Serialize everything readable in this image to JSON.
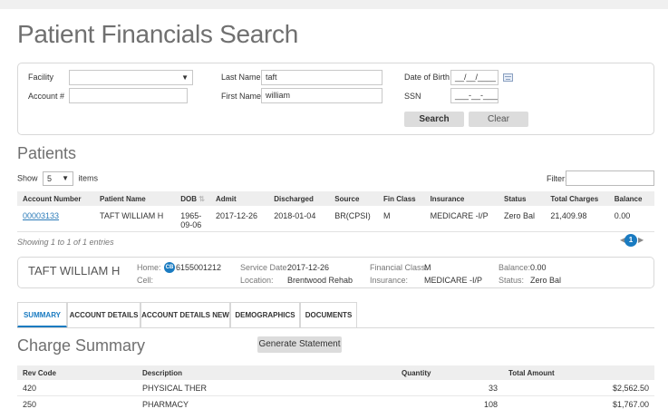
{
  "page_title": "Patient Financials Search",
  "search": {
    "facility_label": "Facility",
    "facility_value": "",
    "account_label": "Account #",
    "account_value": "",
    "last_name_label": "Last Name",
    "last_name_value": "taft",
    "first_name_label": "First Name",
    "first_name_value": "william",
    "dob_label": "Date of Birth",
    "dob_value": "__/__/____",
    "ssn_label": "SSN",
    "ssn_value": "___-__-____",
    "search_label": "Search",
    "clear_label": "Clear"
  },
  "patients": {
    "title": "Patients",
    "show_label": "Show",
    "show_value": "5",
    "items_label": "items",
    "filter_label": "Filter:",
    "columns": [
      "Account Number",
      "Patient Name",
      "DOB",
      "Admit",
      "Discharged",
      "Source",
      "Fin Class",
      "Insurance",
      "Status",
      "Total Charges",
      "Balance"
    ],
    "rows": [
      {
        "account": "00003133",
        "name": "TAFT WILLIAM H",
        "dob_line1": "1965-",
        "dob_line2": "09-06",
        "admit": "2017-12-26",
        "discharged": "2018-01-04",
        "source": "BR(CPSI)",
        "fin_class": "M",
        "insurance": "MEDICARE -I/P",
        "status": "Zero Bal",
        "total_charges": "21,409.98",
        "balance": "0.00"
      }
    ],
    "showing": "Showing 1 to 1 of 1 entries",
    "page": "1"
  },
  "patient_card": {
    "name": "TAFT WILLIAM H",
    "home_label": "Home:",
    "home_value": "6155001212",
    "cell_label": "Cell:",
    "cb_badge": "CB",
    "service_date_label": "Service Date:",
    "service_date_value": "2017-12-26",
    "location_label": "Location:",
    "location_value": "Brentwood Rehab",
    "fin_class_label": "Financial Class:",
    "fin_class_value": "M",
    "insurance_label": "Insurance:",
    "insurance_value": "MEDICARE -I/P",
    "balance_label": "Balance:",
    "balance_value": "0.00",
    "status_label": "Status:",
    "status_value": "Zero Bal"
  },
  "tabs": [
    "SUMMARY",
    "ACCOUNT DETAILS",
    "ACCOUNT DETAILS NEW",
    "DEMOGRAPHICS",
    "DOCUMENTS"
  ],
  "charge_summary": {
    "title": "Charge Summary",
    "generate_label": "Generate Statement",
    "columns": [
      "Rev Code",
      "Description",
      "Quantity",
      "Total Amount"
    ],
    "rows": [
      {
        "rev_code": "420",
        "description": "PHYSICAL THER",
        "quantity": "33",
        "amount": "$2,562.50"
      },
      {
        "rev_code": "250",
        "description": "PHARMACY",
        "quantity": "108",
        "amount": "$1,767.00"
      }
    ]
  },
  "colors": {
    "accent": "#1a7bc1",
    "link": "#2a7ab8"
  }
}
